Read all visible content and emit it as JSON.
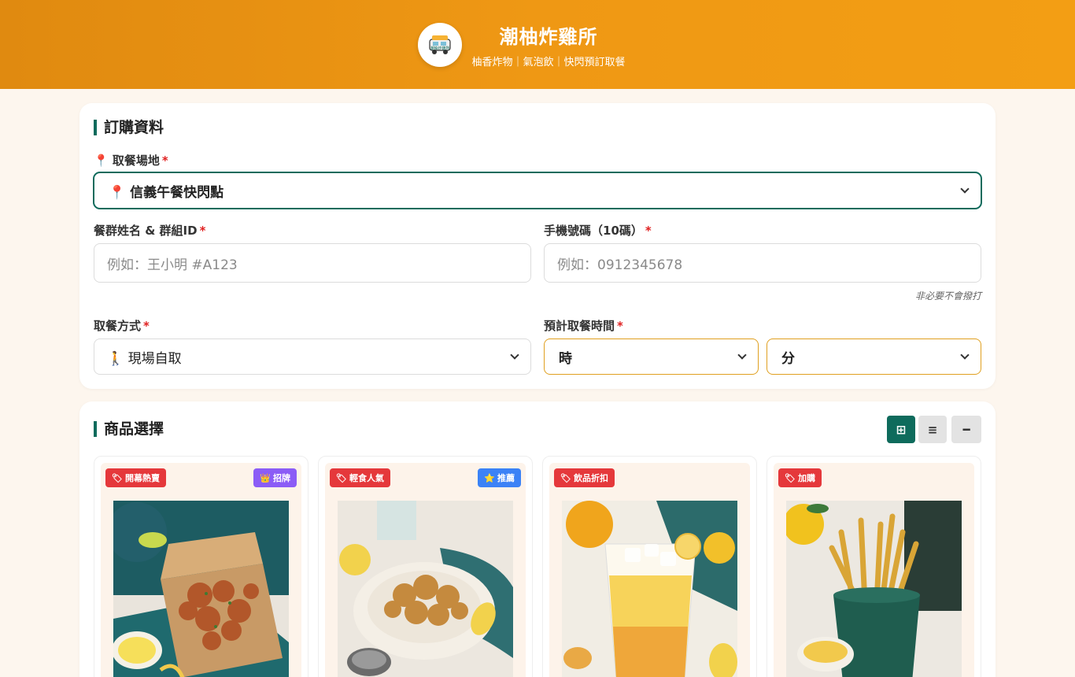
{
  "header": {
    "title": "潮柚炸雞所",
    "subtitle": "柚香炸物｜氣泡飲｜快閃預訂取餐",
    "logo_text": "潮柚炸雞所"
  },
  "order": {
    "section_title": "訂購資料",
    "location_label": "📍 取餐場地",
    "location_value": "📍 信義午餐快閃點",
    "name_label": "餐群姓名 & 群組ID",
    "name_placeholder": "例如：王小明 #A123",
    "phone_label": "手機號碼（10碼）",
    "phone_placeholder": "例如：0912345678",
    "phone_hint": "非必要不會撥打",
    "method_label": "取餐方式",
    "method_value": "🚶 現場自取",
    "time_label": "預計取餐時間",
    "hour_value": "時",
    "minute_value": "分",
    "required_mark": "*"
  },
  "products": {
    "section_title": "商品選擇",
    "view_icons": [
      "grid-view-icon",
      "list-view-icon",
      "compact-view-icon"
    ],
    "view_glyphs": [
      "⊞",
      "≡",
      "━"
    ],
    "items": [
      {
        "tag": "開幕熱賣",
        "badge": "招牌",
        "badge_icon": "crown-icon",
        "badge_color": "#8b5cf6"
      },
      {
        "tag": "輕食人氣",
        "badge": "推薦",
        "badge_icon": "star-icon",
        "badge_color": "#3b82f6"
      },
      {
        "tag": "飲品折扣",
        "badge": "",
        "badge_icon": "",
        "badge_color": ""
      },
      {
        "tag": "加購",
        "badge": "",
        "badge_icon": "",
        "badge_color": ""
      }
    ]
  },
  "colors": {
    "header_gradient_start": "#e08a10",
    "header_gradient_end": "#f39e14",
    "accent_green": "#0e6b5c",
    "tag_red": "#e5383b",
    "required_red": "#e02020"
  }
}
